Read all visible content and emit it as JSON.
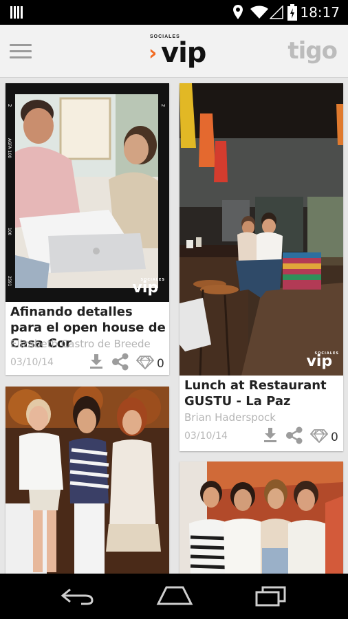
{
  "status_bar": {
    "time": "18:17"
  },
  "app_bar": {
    "logo_small_text": "SOCIALES",
    "logo_text": "vip",
    "brand": "tigo"
  },
  "colors": {
    "accent": "#f26a21",
    "card_bg": "#ffffff",
    "page_bg": "#e6e6e6"
  },
  "watermark": {
    "small": "SOCIALES",
    "text": "vip"
  },
  "posts": [
    {
      "title": "Afinando detalles para el open house de Casa Cor",
      "author": "Elizabeth Castro de Breede",
      "date": "03/10/14",
      "likes": "0"
    },
    {
      "title": "Lunch at Restaurant GUSTU - La Paz",
      "author": "Brian Haderspock",
      "date": "03/10/14",
      "likes": "0"
    },
    {
      "title": "",
      "author": "",
      "date": "",
      "likes": ""
    },
    {
      "title": "",
      "author": "",
      "date": "",
      "likes": ""
    }
  ],
  "icons": {
    "download": "download-icon",
    "share": "share-icon",
    "diamond": "diamond-icon",
    "menu": "hamburger-menu-icon",
    "back": "back-icon",
    "home": "home-icon",
    "recents": "recents-icon"
  }
}
